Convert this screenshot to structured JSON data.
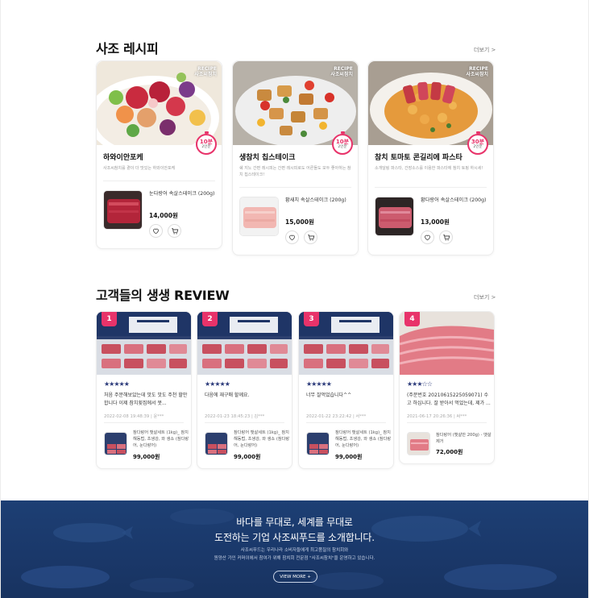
{
  "recipe_section": {
    "title": "사조 레시피",
    "more": "더보기 >",
    "cards": [
      {
        "brand": "RECIPE\n사조씨참치",
        "time": "10분",
        "serving": "2인분",
        "name": "하와이안포케",
        "desc": "사조씨참치를 곁이 더 맛있는 하와이안포케",
        "product_name": "눈다랑어 속살스테이크 (200g)",
        "price": "14,000원"
      },
      {
        "brand": "RECIPE\n사조씨참치",
        "time": "10분",
        "serving": "2인분",
        "name": "생참치 칩스테이크",
        "desc": "쉐 지노 간편 레시피는 간편 레시피로도 어른들도 모두 좋아하는 참치 칩스테이크!",
        "product_name": "황새치 속살스테이크 (200g)",
        "price": "15,000원"
      },
      {
        "brand": "RECIPE\n사조씨참치",
        "time": "30분",
        "serving": "2인분",
        "name": "참치 토마토 콘길리에 파스타",
        "desc": "소개달링 파스타, 간장소스를 이용한 파스타에 참치 토핑 하시세!",
        "product_name": "황다랑어 속살스테이크 (200g)",
        "price": "13,000원"
      }
    ]
  },
  "review_section": {
    "title": "고객들의 생생 REVIEW",
    "more": "더보기 >",
    "cards": [
      {
        "rank": "1",
        "stars": "★★★★★",
        "text": "처음 주문해보았는데 맛도 맛도 주천 할만 합니다 이제 참치횟집에서 못...",
        "meta": "2022-02-08 19:48:39 | 윤***",
        "product": "참다랑어 뱃살세트 (1kg)_ 참치 해동법, 초생강, 와 생쇼 (참다랑어, 눈다랑어)",
        "price": "99,000원"
      },
      {
        "rank": "2",
        "stars": "★★★★★",
        "text": "다음에 재구매 할께요.",
        "meta": "2022-01-23 18:45:23 | 김***",
        "product": "참다랑어 뱃살세트 (1kg)_ 참치 해동법, 초생강, 와 생쇼 (참다랑어, 눈다랑어)",
        "price": "99,000원"
      },
      {
        "rank": "3",
        "stars": "★★★★★",
        "text": "너무 잘먹었습니다^^",
        "meta": "2022-01-22 23:22:42 | 서***",
        "product": "참다랑어 뱃살세트 (1kg)_ 참치 해동법, 초생강, 와 생쇼 (참다랑어, 눈다랑어)",
        "price": "99,000원"
      },
      {
        "rank": "4",
        "stars": "★★★☆☆",
        "text": "(주문번호 20210615225059071) 수고 하십니다. 잘 받아서 먹었는데, 제가 ...",
        "meta": "2021-06-17 20:26:36 | 써***",
        "product": "참다랑어 (뱃살만 200g) - 뱃살제거",
        "price": "72,000원"
      }
    ]
  },
  "banner": {
    "line1": "바다를 무대로, 세계를 무대로",
    "line2": "도전하는 기업 사조씨푸드를 소개합니다.",
    "desc1": "사조씨푸드는 우리나라 소비자들에게 최고품질의 참치회와",
    "desc2": "원양산 가인 커머이에서 참여가 위해 참치회 전문점 \"사조씨참치\"을 운영하고 있습니다.",
    "button": "VIEW MORE +"
  },
  "colors": {
    "accent": "#e8336a",
    "star": "#2b3a7a",
    "banner_bg": "#1d3f74"
  }
}
